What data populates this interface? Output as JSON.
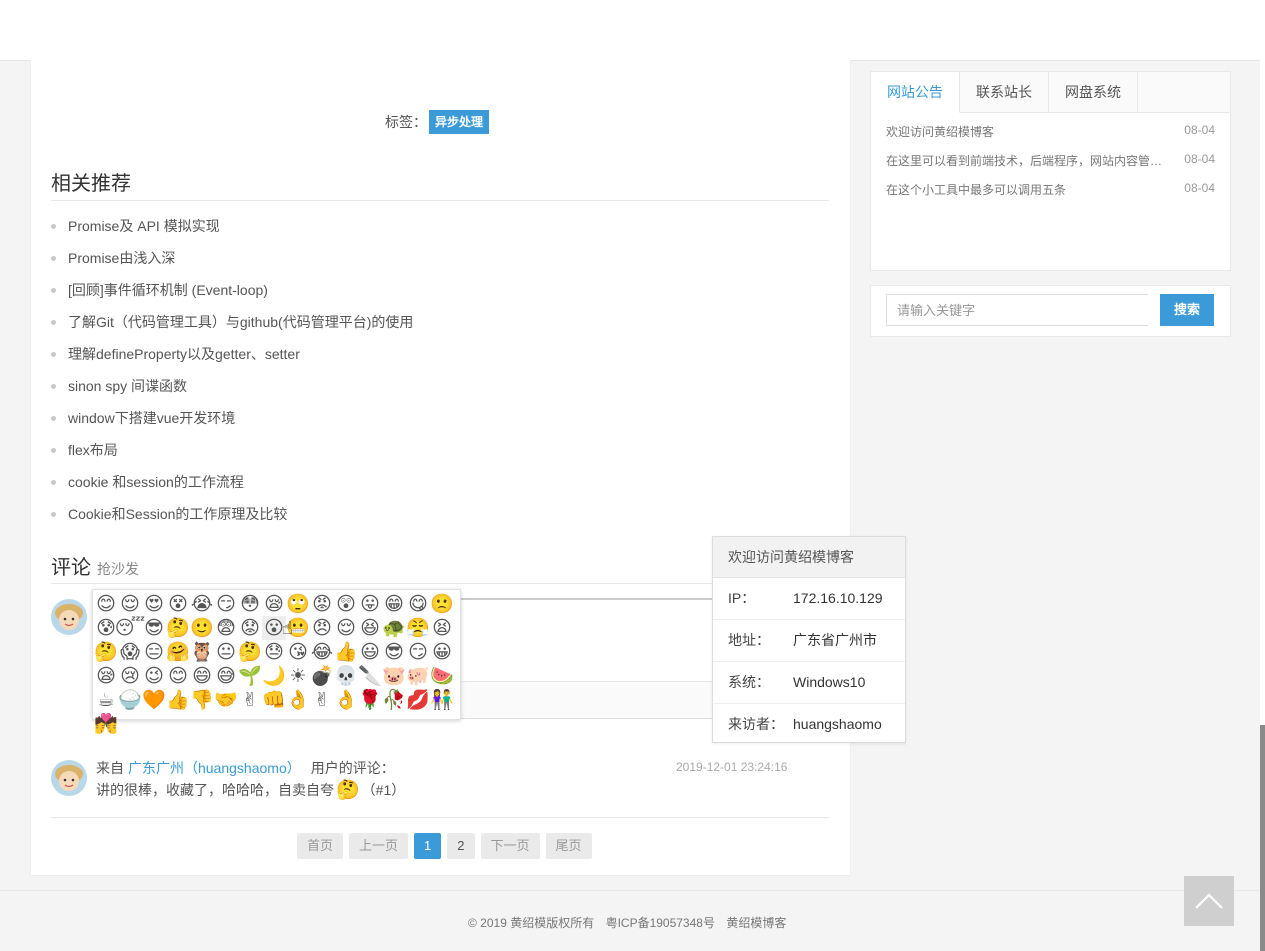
{
  "tags": {
    "label": "标签：",
    "items": [
      "异步处理"
    ]
  },
  "related": {
    "title": "相关推荐",
    "items": [
      "Promise及 API 模拟实现",
      "Promise由浅入深",
      "[回顾]事件循环机制 (Event-loop)",
      "了解Git（代码管理工具）与github(代码管理平台)的使用",
      "理解defineProperty以及getter、setter",
      "sinon spy 间谍函数",
      "window下搭建vue开发环境",
      "flex布局",
      "cookie 和session的工作流程",
      "Cookie和Session的工作原理及比较"
    ]
  },
  "comments": {
    "title": "评论",
    "subtitle": "抢沙发",
    "emoji_icons": [
      "smile",
      "smile",
      "heart-eyes",
      "dizzy",
      "crying",
      "smirk",
      "shy",
      "sleepy",
      "sleepy",
      "angry",
      "confused",
      "tongue",
      "grin",
      "smirk",
      "sad",
      "sweat",
      "lazy",
      "cool",
      "thinking",
      "smile",
      "scared",
      "sad",
      "mouth",
      "grin",
      "angry",
      "relieved",
      "grin",
      "turtle",
      "pout",
      "tired",
      "thinking",
      "shock",
      "smile",
      "hug",
      "owl",
      "neutral",
      "thinking",
      "sweat",
      "kiss",
      "laugh",
      "thumbs",
      "grin",
      "cool",
      "smirk",
      "grin",
      "sleep",
      "sad",
      "wink",
      "shy",
      "grin",
      "laugh",
      "sprout",
      "moon",
      "sun",
      "bomb",
      "skull",
      "knife",
      "pig-face",
      "pig",
      "watermelon",
      "coffee",
      "rice",
      "heart",
      "thumbs-up",
      "thumbs-down",
      "handshake",
      "victory",
      "fist",
      "ok",
      "peace",
      "ok-hand",
      "rose",
      "wilted-rose",
      "lips",
      "couple",
      "couple"
    ],
    "emoji_glyphs": [
      "😊",
      "😌",
      "😍",
      "😵",
      "😭",
      "😏",
      "😳",
      "😪",
      "🙄",
      "😡",
      "😲",
      "😛",
      "😁",
      "😋",
      "🙁",
      "😰",
      "😴",
      "😎",
      "🤔",
      "🙂",
      "😨",
      "😟",
      "😮",
      "😬",
      "😠",
      "😌",
      "😆",
      "🐢",
      "😤",
      "😫",
      "🤔",
      "😱",
      "😑",
      "🤗",
      "🦉",
      "😐",
      "🤔",
      "😓",
      "😘",
      "😂",
      "👍",
      "😃",
      "😎",
      "😏",
      "😀",
      "😪",
      "😢",
      "😉",
      "😊",
      "😄",
      "😅",
      "🌱",
      "🌙",
      "☀",
      "💣",
      "💀",
      "🔪",
      "🐷",
      "🐖",
      "🍉",
      "☕",
      "🍚",
      "🧡",
      "👍",
      "👎",
      "🤝",
      "✌",
      "👊",
      "👌",
      "✌",
      "👌",
      "🌹",
      "🥀",
      "💋",
      "👫",
      "💏"
    ],
    "entry": {
      "prefix": "来自",
      "user": "广东广州（huangshaomo）",
      "suffix": "用户的评论：",
      "time": "2019-12-01 23:24:16",
      "text": "讲的很棒，收藏了，哈哈哈，自卖自夸",
      "emoji": "🤔",
      "index": "（#1）"
    }
  },
  "visitor": {
    "title": "欢迎访问黄绍模博客",
    "rows": [
      {
        "key": "IP：",
        "value": "172.16.10.129"
      },
      {
        "key": "地址：",
        "value": "广东省广州市"
      },
      {
        "key": "系统：",
        "value": "Windows10"
      },
      {
        "key": "来访者：",
        "value": "huangshaomo"
      }
    ]
  },
  "pagination": {
    "first": "首页",
    "prev": "上一页",
    "pages": [
      "1",
      "2"
    ],
    "current": "1",
    "next": "下一页",
    "last": "尾页"
  },
  "sidebar": {
    "tabs": [
      "网站公告",
      "联系站长",
      "网盘系统"
    ],
    "active_tab": "网站公告",
    "notices": [
      {
        "text": "欢迎访问黄绍模博客",
        "date": "08-04"
      },
      {
        "text": "在这里可以看到前端技术，后端程序，网站内容管理系统等文章",
        "date": "08-04"
      },
      {
        "text": "在这个小工具中最多可以调用五条",
        "date": "08-04"
      }
    ]
  },
  "search": {
    "placeholder": "请输入关键字",
    "button": "搜索"
  },
  "footer": {
    "copyright": "© 2019 黄绍模版权所有",
    "icp": "粤ICP备19057348号",
    "site": "黄绍模博客"
  },
  "colors": {
    "accent": "#3a9bd8",
    "page_bg": "#f4f4f4"
  }
}
